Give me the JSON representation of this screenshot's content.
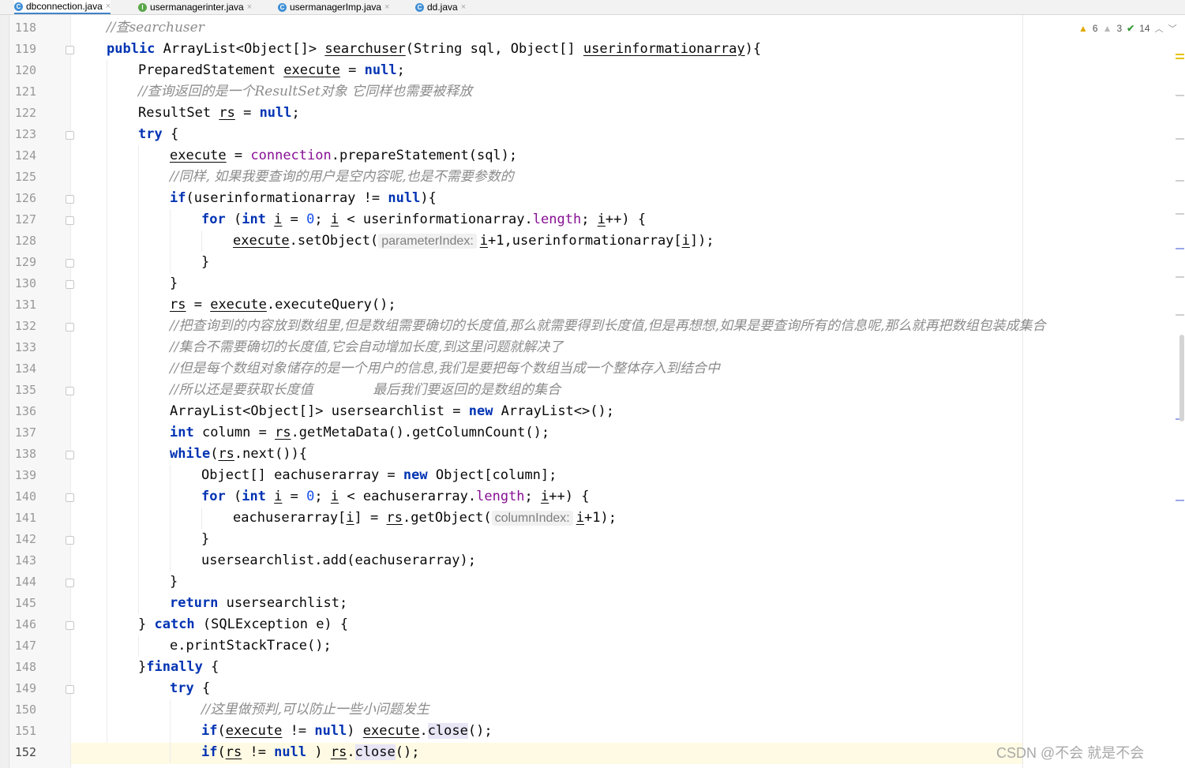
{
  "tabs": [
    {
      "label": "dbconnection.java",
      "icon": "C",
      "active": true
    },
    {
      "label": "usermanagerinter.java",
      "icon": "I",
      "active": false
    },
    {
      "label": "usermanagerImp.java",
      "icon": "C",
      "active": false
    },
    {
      "label": "dd.java",
      "icon": "C",
      "active": false
    }
  ],
  "tab_close_glyph": "×",
  "inspections": {
    "warnings": "6",
    "weak_warnings": "3",
    "ok": "14"
  },
  "line_numbers": [
    "118",
    "119",
    "120",
    "121",
    "122",
    "123",
    "124",
    "125",
    "126",
    "127",
    "128",
    "129",
    "130",
    "131",
    "132",
    "133",
    "134",
    "135",
    "136",
    "137",
    "138",
    "139",
    "140",
    "141",
    "142",
    "143",
    "144",
    "145",
    "146",
    "147",
    "148",
    "149",
    "150",
    "151",
    "152"
  ],
  "code": {
    "l118_comment": "//查searchuser",
    "l119": {
      "kw": "public",
      "type": " ArrayList<Object[]> ",
      "name": "searchuser",
      "params": "(String sql, Object[] ",
      "param2": "userinformationarray",
      "end": "){"
    },
    "l120": {
      "type": "PreparedStatement ",
      "var": "execute",
      "eq": " = ",
      "kw": "null",
      "end": ";"
    },
    "l121_comment": "//查询返回的是一个ResultSet对象 它同样也需要被释放",
    "l122": {
      "type": "ResultSet ",
      "var": "rs",
      "eq": " = ",
      "kw": "null",
      "end": ";"
    },
    "l123": {
      "kw": "try",
      "end": " {"
    },
    "l124": {
      "var": "execute",
      "eq": " = ",
      "fld": "connection",
      "rest": ".prepareStatement(sql);"
    },
    "l125_comment": "//同样, 如果我要查询的用户是空内容呢,也是不需要参数的",
    "l126": {
      "kw": "if",
      "mid": "(userinformationarray != ",
      "kw2": "null",
      "end": "){"
    },
    "l127": {
      "kw": "for",
      "p1": " (",
      "kw2": "int",
      "sp": " ",
      "i1": "i",
      "eq": " = ",
      "num": "0",
      "semi": "; ",
      "i2": "i",
      "lt": " < userinformationarray.",
      "fld": "length",
      "semi2": "; ",
      "i3": "i",
      "end": "++) {"
    },
    "l128": {
      "var": "execute",
      "call": ".setObject(",
      "hint": "parameterIndex:",
      "i": "i",
      "rest": "+1,userinformationarray[",
      "i2": "i",
      "end": "]);"
    },
    "l129": "}",
    "l130": "}",
    "l131": {
      "var": "rs",
      "eq": " = ",
      "var2": "execute",
      "rest": ".executeQuery();"
    },
    "l132_comment": "//把查询到的内容放到数组里,但是数组需要确切的长度值,那么就需要得到长度值,但是再想想,如果是要查询所有的信息呢,那么就再把数组包装成集合",
    "l133_comment": "//集合不需要确切的长度值,它会自动增加长度,到这里问题就解决了",
    "l134_comment": "//但是每个数组对象储存的是一个用户的信息,我们是要把每个数组当成一个整体存入到结合中",
    "l135_comment": "//所以还是要获取长度值              最后我们要返回的是数组的集合",
    "l136": {
      "type": "ArrayList<Object[]> ",
      "var": "usersearchlist",
      "eq": " = ",
      "kw": "new",
      "end": " ArrayList<>();"
    },
    "l137": {
      "kw": "int",
      "mid": " column = ",
      "var": "rs",
      "end": ".getMetaData().getColumnCount();"
    },
    "l138": {
      "kw": "while",
      "p": "(",
      "var": "rs",
      "end": ".next()){"
    },
    "l139": {
      "type": "Object[] ",
      "var": "eachuserarray",
      "eq": " = ",
      "kw": "new",
      "end": " Object[column];"
    },
    "l140": {
      "kw": "for",
      "p1": " (",
      "kw2": "int",
      "sp": " ",
      "i1": "i",
      "eq": " = ",
      "num": "0",
      "semi": "; ",
      "i2": "i",
      "lt": " < eachuserarray.",
      "fld": "length",
      "semi2": "; ",
      "i3": "i",
      "end": "++) {"
    },
    "l141": {
      "pre": "eachuserarray[",
      "i": "i",
      "mid": "] = ",
      "var": "rs",
      "call": ".getObject(",
      "hint": "columnIndex:",
      "i2": "i",
      "end": "+1);"
    },
    "l142": "}",
    "l143": "usersearchlist.add(eachuserarray);",
    "l144": "}",
    "l145": {
      "kw": "return",
      "end": " usersearchlist;"
    },
    "l146": {
      "pre": "} ",
      "kw": "catch",
      "end": " (SQLException e) {"
    },
    "l147": "e.printStackTrace();",
    "l148": {
      "pre": "}",
      "kw": "finally",
      "end": " {"
    },
    "l149": {
      "kw": "try",
      "end": " {"
    },
    "l150_comment": "//这里做预判,可以防止一些小问题发生",
    "l151": {
      "kw": "if",
      "p": "(",
      "var": "execute",
      "mid": " != ",
      "kw2": "null",
      "p2": ") ",
      "var2": "execute",
      "dot": ".",
      "hl": "close",
      "end": "();"
    },
    "l152": {
      "kw": "if",
      "p": "(",
      "var": "rs",
      "mid": " != ",
      "kw2": "null",
      "p2": " ) ",
      "var2": "rs",
      "dot": ".",
      "hl": "close",
      "end": "();"
    }
  },
  "watermark": "CSDN @不会 就是不会 ",
  "colors": {
    "keyword": "#0033b3",
    "number": "#1750eb",
    "field": "#871094",
    "comment": "#8c8c8c",
    "tab_underline": "#4083c9"
  }
}
